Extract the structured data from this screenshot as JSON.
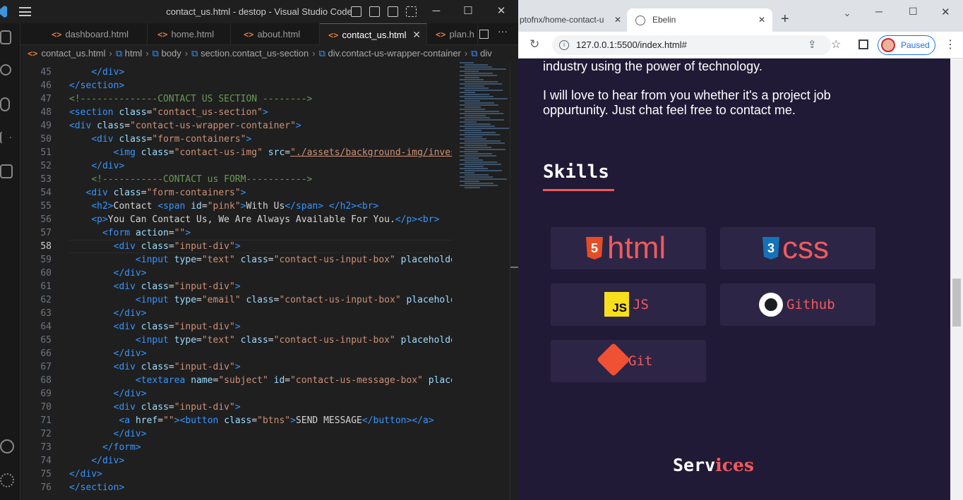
{
  "vscode": {
    "window_title": "contact_us.html - destop - Visual Studio Code",
    "tabs": [
      {
        "label": "dashboard.html"
      },
      {
        "label": "home.html"
      },
      {
        "label": "about.html"
      },
      {
        "label": "contact_us.html"
      },
      {
        "label": "plan.h"
      }
    ],
    "breadcrumb": [
      "contact_us.html",
      "html",
      "body",
      "section.contact_us-section",
      "div.contact-us-wrapper-container",
      "div"
    ],
    "current_line": 58,
    "line_numbers": [
      "45",
      "46",
      "47",
      "48",
      "49",
      "50",
      "51",
      "52",
      "53",
      "54",
      "55",
      "56",
      "57",
      "58",
      "59",
      "60",
      "61",
      "62",
      "63",
      "64",
      "65",
      "66",
      "67",
      "68",
      "69",
      "70",
      "71",
      "72",
      "73",
      "74",
      "75",
      "76"
    ],
    "code": {
      "l45": [
        "    </div>"
      ],
      "l46": "</section>",
      "l47": "<!--------------CONTACT US SECTION -------->",
      "l48_tag": "<section",
      "l48_attr": "class",
      "l48_val": "\"contact_us-section\"",
      "l49_tag": "<div",
      "l49_attr": "class",
      "l49_val": "\"contact-us-wrapper-container\"",
      "l50_tag": "<div",
      "l50_attr": "class",
      "l50_val": "\"form-containers\"",
      "l51_tag": "<img",
      "l51_attr": "class",
      "l51_val": "\"contact-us-img\"",
      "l51_attr2": "src",
      "l51_val2": "\"./assets/background-img/invest",
      "l52": "</div>",
      "l53": "<!-----------CONTACT us FORM----------->",
      "l54_tag": "<div",
      "l54_attr": "class",
      "l54_val": "\"form-containers\"",
      "l55_h2": "<h2>",
      "l55_t1": "Contact ",
      "l55_span": "<span",
      "l55_attr": "id",
      "l55_val": "\"pink\"",
      "l55_t2": "With Us",
      "l55_end": "</span> </h2><br>",
      "l56_p": "<p>",
      "l56_t": "You Can Contact Us, We Are Always Available For You.",
      "l56_end": "</p><br>",
      "l57_tag": "<form",
      "l57_attr": "action",
      "l57_val": "\"\"",
      "l58_tag": "<div",
      "l58_attr": "class",
      "l58_val": "\"input-div\"",
      "l59_tag": "<input",
      "l59_attr": "type",
      "l59_val": "\"text\"",
      "l59_attr2": "class",
      "l59_val2": "\"contact-us-input-box\"",
      "l59_attr3": "placeholder",
      "l60": "</div>",
      "l62_val": "\"email\"",
      "l62_attr3": "placeholde",
      "l68_tag": "<textarea",
      "l68_attr": "name",
      "l68_val": "\"subject\"",
      "l68_attr2": "id",
      "l68_val2": "\"contact-us-message-box\"",
      "l68_attr3": "placeh",
      "l71_a": "<a",
      "l71_attr": "href",
      "l71_val": "\"\"",
      "l71_btn": "<button",
      "l71_val2": "\"btns\"",
      "l71_t": "SEND MESSAGE",
      "l71_end": "</button></a>",
      "l73": "</form>",
      "l75": "</div>",
      "l76": "</section>"
    }
  },
  "browser": {
    "tabs": [
      {
        "label": "ptofnx/home-contact-u"
      },
      {
        "label": "Ebelin"
      }
    ],
    "url": "127.0.0.1:5500/index.html#",
    "profile_label": "Paused",
    "page": {
      "intro_line": "industry using the power of technology.",
      "para": "I will love to hear from you whether it's a project job oppurtunity. Just chat feel free to contact me.",
      "skills_title": "Skills",
      "skills": [
        {
          "label": "html",
          "icon": "html5-icon",
          "icon_text": "5"
        },
        {
          "label": "css",
          "icon": "css3-icon",
          "icon_text": "3"
        },
        {
          "label": "JS",
          "icon": "js-icon",
          "icon_text": "JS"
        },
        {
          "label": "Github",
          "icon": "github-icon"
        },
        {
          "label": "Git",
          "icon": "git-icon"
        }
      ],
      "services_title_a": "Serv",
      "services_title_b": "ices"
    },
    "colors": {
      "accent": "#f05a5e",
      "page_bg": "#211a36",
      "card_bg": "#2d2546"
    }
  }
}
